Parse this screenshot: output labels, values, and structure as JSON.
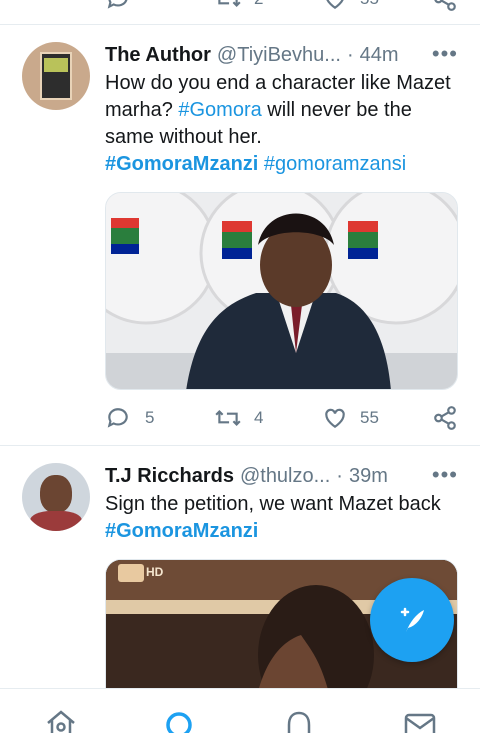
{
  "top_actions": {
    "retweets": "2",
    "likes": "55"
  },
  "tweets": [
    {
      "author_name": "The Author",
      "handle": "@TiyiBevhu...",
      "separator": "·",
      "time": "44m",
      "more": "•••",
      "text_plain": "How do you end a character like Mazet marha? ",
      "tag1": "#Gomora",
      "text_after": " will never be the same without her.",
      "tag2": "#GomoraMzanzi",
      "tag3": "#gomoramzansi",
      "media_desc": "commission-of-inquiry-photo",
      "replies": "5",
      "retweets": "4",
      "likes": "55"
    },
    {
      "author_name": "T.J Ricchards",
      "handle": "@thulzo...",
      "separator": "·",
      "time": "39m",
      "more": "•••",
      "text_plain": "Sign the petition, we want Mazet back",
      "tag1": "#GomoraMzanzi",
      "media_label": "HD"
    }
  ],
  "colors": {
    "accent": "#1da1f2",
    "link": "#1b95e0",
    "muted": "#657786"
  },
  "nav": [
    "home-icon",
    "search-icon",
    "notifications-icon",
    "messages-icon"
  ]
}
